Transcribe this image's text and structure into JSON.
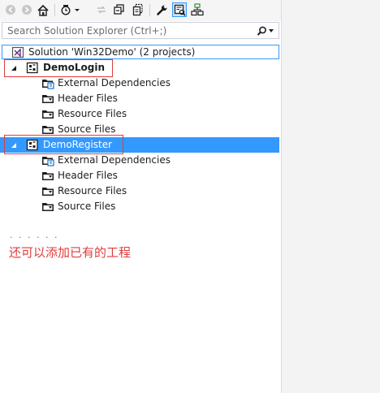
{
  "search": {
    "placeholder": "Search Solution Explorer (Ctrl+;)"
  },
  "tree": {
    "solution_label": "Solution 'Win32Demo' (2 projects)",
    "projects": [
      {
        "name": "DemoLogin",
        "expanded": true,
        "children": [
          "External Dependencies",
          "Header Files",
          "Resource Files",
          "Source Files"
        ]
      },
      {
        "name": "DemoRegister",
        "expanded": true,
        "selected": true,
        "children": [
          "External Dependencies",
          "Header Files",
          "Resource Files",
          "Source Files"
        ]
      }
    ]
  },
  "annotation": {
    "dots": ". . . . . .",
    "text": "还可以添加已有的工程"
  },
  "colors": {
    "selection": "#3399ff",
    "highlight_box": "#e03c3c",
    "annotation": "#e03c3c"
  }
}
